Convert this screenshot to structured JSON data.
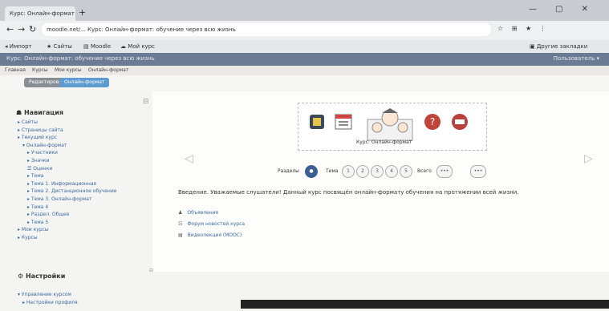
{
  "browser": {
    "tab_title": "Курс: Онлайн-формат",
    "new_tab": "+",
    "window_controls": "— ▢ ✕",
    "nav_back": "←",
    "nav_forward": "→",
    "nav_reload": "↻",
    "url": "moodle.net/... Курс: Онлайн-формат: обучение через всю жизнь",
    "url_icons": "☆ ⊞ ★ ⋮",
    "bookmarks": [
      "◂ Импорт",
      "★ Сайты",
      "▤ Moodle",
      "☁ Мой курс"
    ],
    "bookmarks_right": "▣ Другие закладки"
  },
  "moodle_bar": {
    "title": "Курс: Онлайн-формат: обучение через всю жизнь",
    "user": "Пользователь ▾"
  },
  "breadcrumbs": [
    "Главная",
    "Курсы",
    "Мои курсы",
    "Онлайн-формат"
  ],
  "toolbar": {
    "button_a": "Редактировать",
    "button_b": "Онлайн-формат"
  },
  "sidebar": {
    "heading": "Навигация",
    "toggle": "⊟",
    "items": [
      "▸ Сайты",
      "▸ Страницы сайта",
      "▸ Текущий курс",
      "▾ Онлайн-формат",
      "▸ Участники",
      "▸ Значки",
      "☰ Оценки",
      "▸ Тема",
      "▸ Тема 1. Информационная",
      "▸ Тема 2. Дистанционное обучение",
      "▸ Тема 3. Онлайн-формат",
      "▸ Тема 4",
      "▸ Раздел. Общее",
      "▸ Тема 5",
      "▸ Мои курсы",
      "▸ Курсы"
    ],
    "settings_heading": "Настройки",
    "settings_items": [
      "▾ Управление курсом",
      "▸ Настройки профиля"
    ]
  },
  "content": {
    "collapse": "⊟",
    "caption": "Курс: Онлайн-формат",
    "pager_label_left": "Разделы",
    "pager_label_mid": "Тема",
    "pager_pages": [
      "1",
      "2",
      "3",
      "4",
      "5"
    ],
    "pager_label_right": "Всего",
    "pager_extra": [
      "•••",
      "•••"
    ],
    "arrow_left": "◁",
    "arrow_right": "▷",
    "intro": "Введение. Уважаемые слушатели! Данный курс посвящён онлайн-формату обучения на протяжении всей жизни.",
    "resources": [
      {
        "icon": "♟",
        "label": "Объявления"
      },
      {
        "icon": "☷",
        "label": "Форум новостей курса"
      },
      {
        "icon": "▤",
        "label": "Видеолекция (MOOC)"
      }
    ]
  },
  "colors": {
    "moodle_bar": "#6b7b93",
    "accent": "#5f9ad0"
  }
}
